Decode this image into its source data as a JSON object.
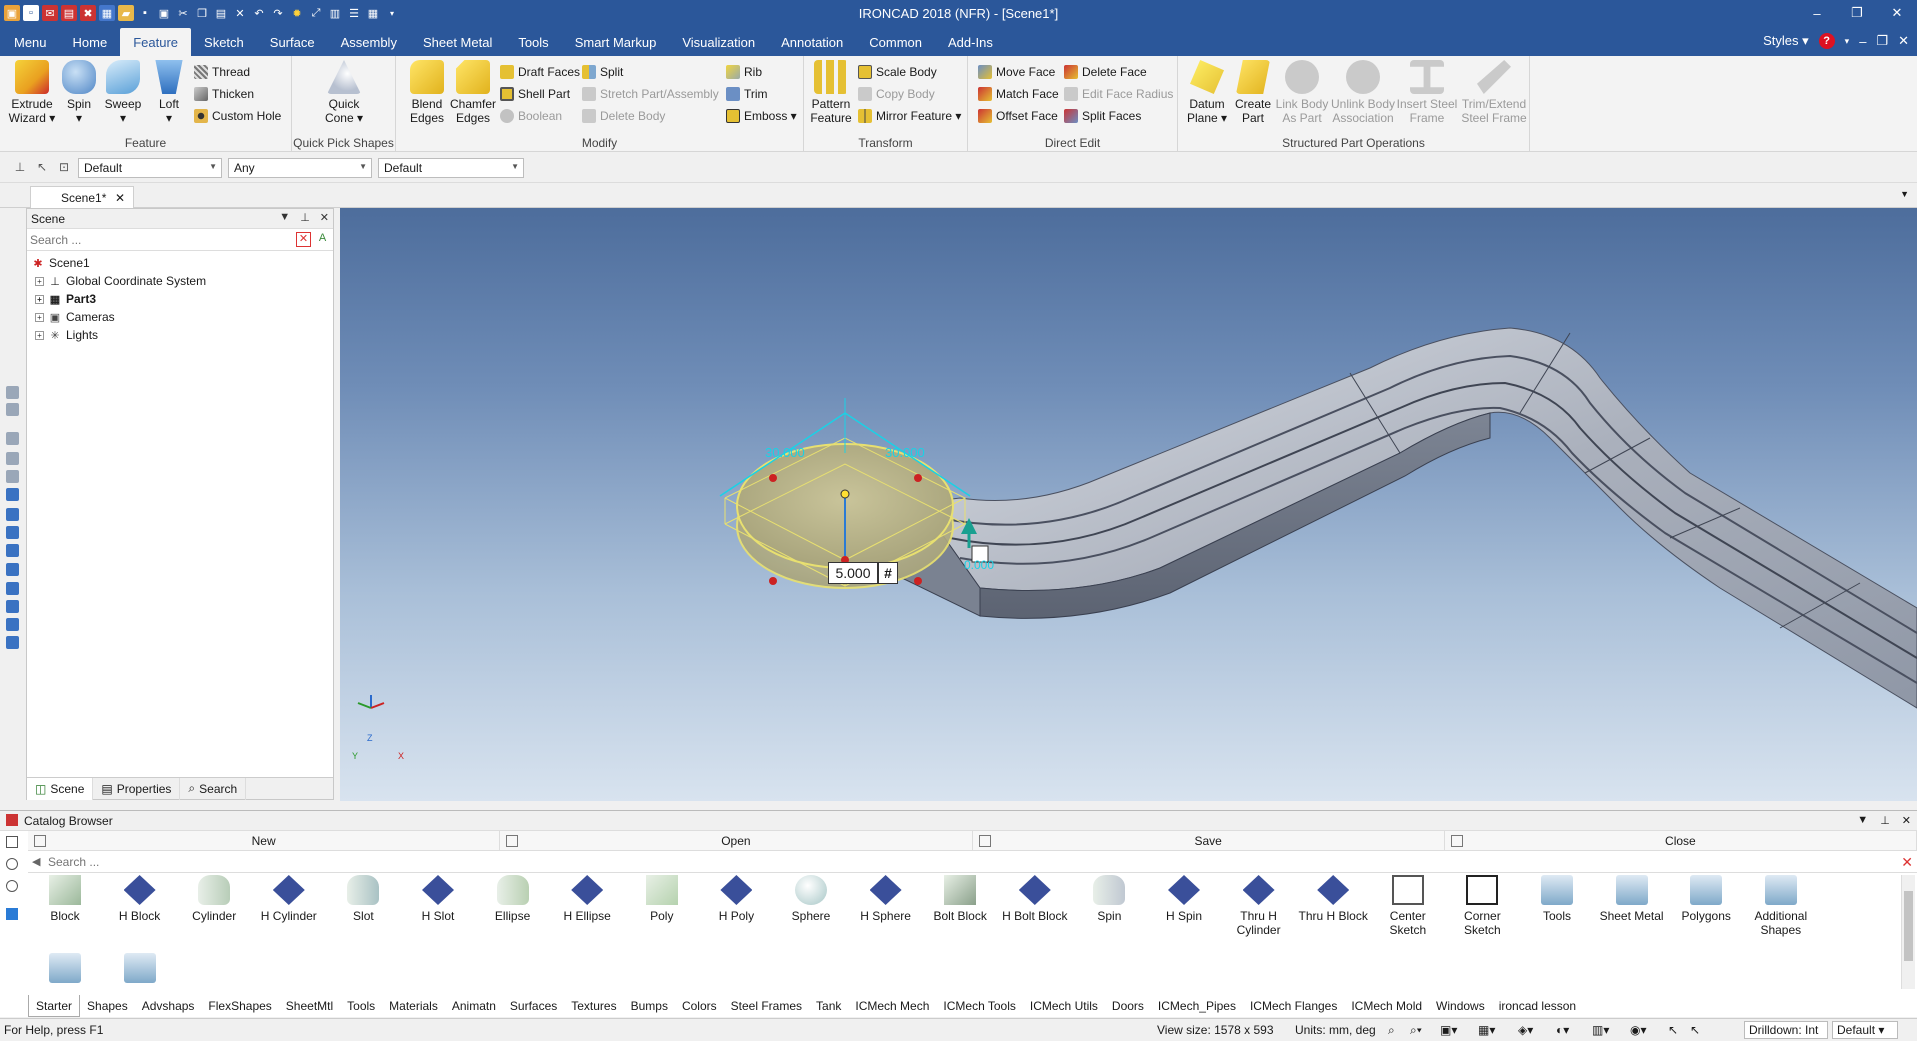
{
  "window": {
    "title": "IRONCAD 2018 (NFR) - [Scene1*]",
    "controls": [
      "–",
      "❐",
      "✕"
    ]
  },
  "menu": {
    "tabs": [
      "Menu",
      "Home",
      "Feature",
      "Sketch",
      "Surface",
      "Assembly",
      "Sheet Metal",
      "Tools",
      "Smart Markup",
      "Visualization",
      "Annotation",
      "Common",
      "Add-Ins"
    ],
    "active": "Feature",
    "styles_label": "Styles"
  },
  "ribbon": {
    "feature": {
      "label": "Feature",
      "extrude": [
        "Extrude",
        "Wizard ▾"
      ],
      "spin": [
        "Spin",
        "▾"
      ],
      "sweep": [
        "Sweep",
        "▾"
      ],
      "loft": [
        "Loft",
        "▾"
      ],
      "thread": "Thread",
      "thicken": "Thicken",
      "custom_hole": "Custom Hole"
    },
    "quick_pick": {
      "label": "Quick Pick Shapes",
      "quick_cone": [
        "Quick",
        "Cone ▾"
      ]
    },
    "modify": {
      "label": "Modify",
      "blend": [
        "Blend",
        "Edges"
      ],
      "chamfer": [
        "Chamfer",
        "Edges"
      ],
      "draft_faces": "Draft Faces",
      "shell_part": "Shell Part",
      "boolean": "Boolean",
      "split": "Split",
      "stretch": "Stretch Part/Assembly",
      "delete_body": "Delete Body",
      "rib": "Rib",
      "trim": "Trim",
      "emboss": "Emboss ▾"
    },
    "transform": {
      "label": "Transform",
      "pattern": [
        "Pattern",
        "Feature"
      ],
      "scale_body": "Scale Body",
      "copy_body": "Copy Body",
      "mirror_feature": "Mirror Feature ▾"
    },
    "direct_edit": {
      "label": "Direct Edit",
      "move_face": "Move Face",
      "match_face": "Match Face",
      "offset_face": "Offset Face",
      "delete_face": "Delete Face",
      "edit_face_radius": "Edit Face Radius",
      "split_faces": "Split Faces"
    },
    "structured": {
      "label": "Structured Part Operations",
      "datum_plane": [
        "Datum",
        "Plane ▾"
      ],
      "create_part": [
        "Create",
        "Part"
      ],
      "link_body": [
        "Link Body",
        "As Part"
      ],
      "unlink_body": [
        "Unlink Body",
        "Association"
      ],
      "insert_steel": [
        "Insert Steel",
        "Frame"
      ],
      "trim_extend": [
        "Trim/Extend",
        "Steel Frame"
      ]
    }
  },
  "toolbar": {
    "combo1": "Default",
    "combo2": "Any",
    "combo3": "Default"
  },
  "document": {
    "tab": "Scene1*"
  },
  "scene_panel": {
    "title": "Scene",
    "search_placeholder": "Search ...",
    "tree": [
      {
        "label": "Scene1",
        "icon": "scene-icon",
        "bold": false
      },
      {
        "label": "Global Coordinate System",
        "icon": "axes-icon",
        "bold": false
      },
      {
        "label": "Part3",
        "icon": "part-icon",
        "bold": true
      },
      {
        "label": "Cameras",
        "icon": "camera-icon",
        "bold": false
      },
      {
        "label": "Lights",
        "icon": "light-icon",
        "bold": false
      }
    ],
    "tabs": [
      "Scene",
      "Properties",
      "Search"
    ]
  },
  "viewport": {
    "dimension_value": "5.000",
    "dimension_hash": "#",
    "dim_label_1": "30.000",
    "dim_label_2": "30.000",
    "dim_label_3": "0.000",
    "triad": {
      "z": "Z",
      "x": "X",
      "y": "Y"
    }
  },
  "catalog": {
    "title": "Catalog Browser",
    "actions": [
      "New",
      "Open",
      "Save",
      "Close"
    ],
    "search_placeholder": "Search ...",
    "items": [
      {
        "label": "Block",
        "icon": "block-icon",
        "color": "#9bb89a"
      },
      {
        "label": "H Block",
        "icon": "h-block-icon",
        "color": "#3a4f9a"
      },
      {
        "label": "Cylinder",
        "icon": "cylinder-icon",
        "color": "#b8cdb8"
      },
      {
        "label": "H Cylinder",
        "icon": "h-cylinder-icon",
        "color": "#3a4f9a"
      },
      {
        "label": "Slot",
        "icon": "slot-icon",
        "color": "#a9c2c4"
      },
      {
        "label": "H Slot",
        "icon": "h-slot-icon",
        "color": "#3a4f9a"
      },
      {
        "label": "Ellipse",
        "icon": "ellipse-icon",
        "color": "#b9d0b2"
      },
      {
        "label": "H Ellipse",
        "icon": "h-ellipse-icon",
        "color": "#3a4f9a"
      },
      {
        "label": "Poly",
        "icon": "poly-icon",
        "color": "#b5d2ae"
      },
      {
        "label": "H Poly",
        "icon": "h-poly-icon",
        "color": "#3a4f9a"
      },
      {
        "label": "Sphere",
        "icon": "sphere-icon",
        "color": "#a6c6c6"
      },
      {
        "label": "H Sphere",
        "icon": "h-sphere-icon",
        "color": "#3a4f9a"
      },
      {
        "label": "Bolt Block",
        "icon": "bolt-block-icon",
        "color": "#8aa08a"
      },
      {
        "label": "H Bolt Block",
        "icon": "h-bolt-block-icon",
        "color": "#3a4f9a"
      },
      {
        "label": "Spin",
        "icon": "spin-icon",
        "color": "#c0c8d2"
      },
      {
        "label": "H Spin",
        "icon": "h-spin-icon",
        "color": "#3a4f9a"
      },
      {
        "label": "Thru H Cylinder",
        "icon": "thru-h-cylinder-icon",
        "color": "#3a4f9a"
      },
      {
        "label": "Thru H Block",
        "icon": "thru-h-block-icon",
        "color": "#3a4f9a"
      },
      {
        "label": "Center Sketch",
        "icon": "center-sketch-icon",
        "color": "#c03030"
      },
      {
        "label": "Corner Sketch",
        "icon": "corner-sketch-icon",
        "color": "#222222"
      },
      {
        "label": "Tools",
        "icon": "folder-icon",
        "color": "#7fa9c9"
      },
      {
        "label": "Sheet Metal",
        "icon": "folder-icon",
        "color": "#7fa9c9"
      },
      {
        "label": "Polygons",
        "icon": "folder-icon",
        "color": "#7fa9c9"
      },
      {
        "label": "Additional Shapes",
        "icon": "folder-icon",
        "color": "#7fa9c9"
      }
    ],
    "row2_items": [
      {
        "icon": "folder-icon",
        "color": "#7fa9c9"
      },
      {
        "icon": "folder-icon",
        "color": "#7fa9c9"
      }
    ],
    "tabs": [
      "Starter",
      "Shapes",
      "Advshaps",
      "FlexShapes",
      "SheetMtl",
      "Tools",
      "Materials",
      "Animatn",
      "Surfaces",
      "Textures",
      "Bumps",
      "Colors",
      "Steel Frames",
      "Tank",
      "ICMech Mech",
      "ICMech Tools",
      "ICMech Utils",
      "Doors",
      "ICMech_Pipes",
      "ICMech Flanges",
      "ICMech Mold",
      "Windows",
      "ironcad lesson"
    ],
    "active_tab": "Starter"
  },
  "status": {
    "help": "For Help, press F1",
    "view_size": "View size: 1578 x 593",
    "units": "Units: mm, deg",
    "drilldown": "Drilldown: Int",
    "default": "Default"
  },
  "colors": {
    "accent": "#2b579a",
    "selection_yellow": "#e8e070",
    "dimension_cyan": "#19d2e6",
    "handle_red": "#cc2222"
  }
}
